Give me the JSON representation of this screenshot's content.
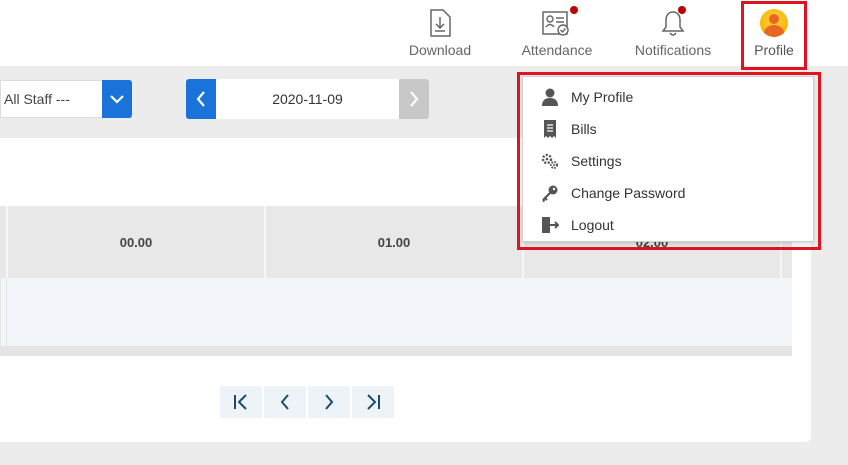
{
  "nav": {
    "download": "Download",
    "attendance": "Attendance",
    "notifications": "Notifications",
    "profile": "Profile"
  },
  "filters": {
    "staff_value": "All Staff ---",
    "date_value": "2020-11-09"
  },
  "grid": {
    "columns": [
      "00.00",
      "01.00",
      "02.00"
    ]
  },
  "profile_menu": {
    "items": [
      {
        "label": "My Profile",
        "icon": "user-icon"
      },
      {
        "label": "Bills",
        "icon": "receipt-icon"
      },
      {
        "label": "Settings",
        "icon": "gears-icon"
      },
      {
        "label": "Change Password",
        "icon": "key-icon"
      },
      {
        "label": "Logout",
        "icon": "logout-icon"
      }
    ]
  },
  "colors": {
    "accent": "#1a73d9",
    "highlight": "#e0141e",
    "badge": "#c00000"
  }
}
